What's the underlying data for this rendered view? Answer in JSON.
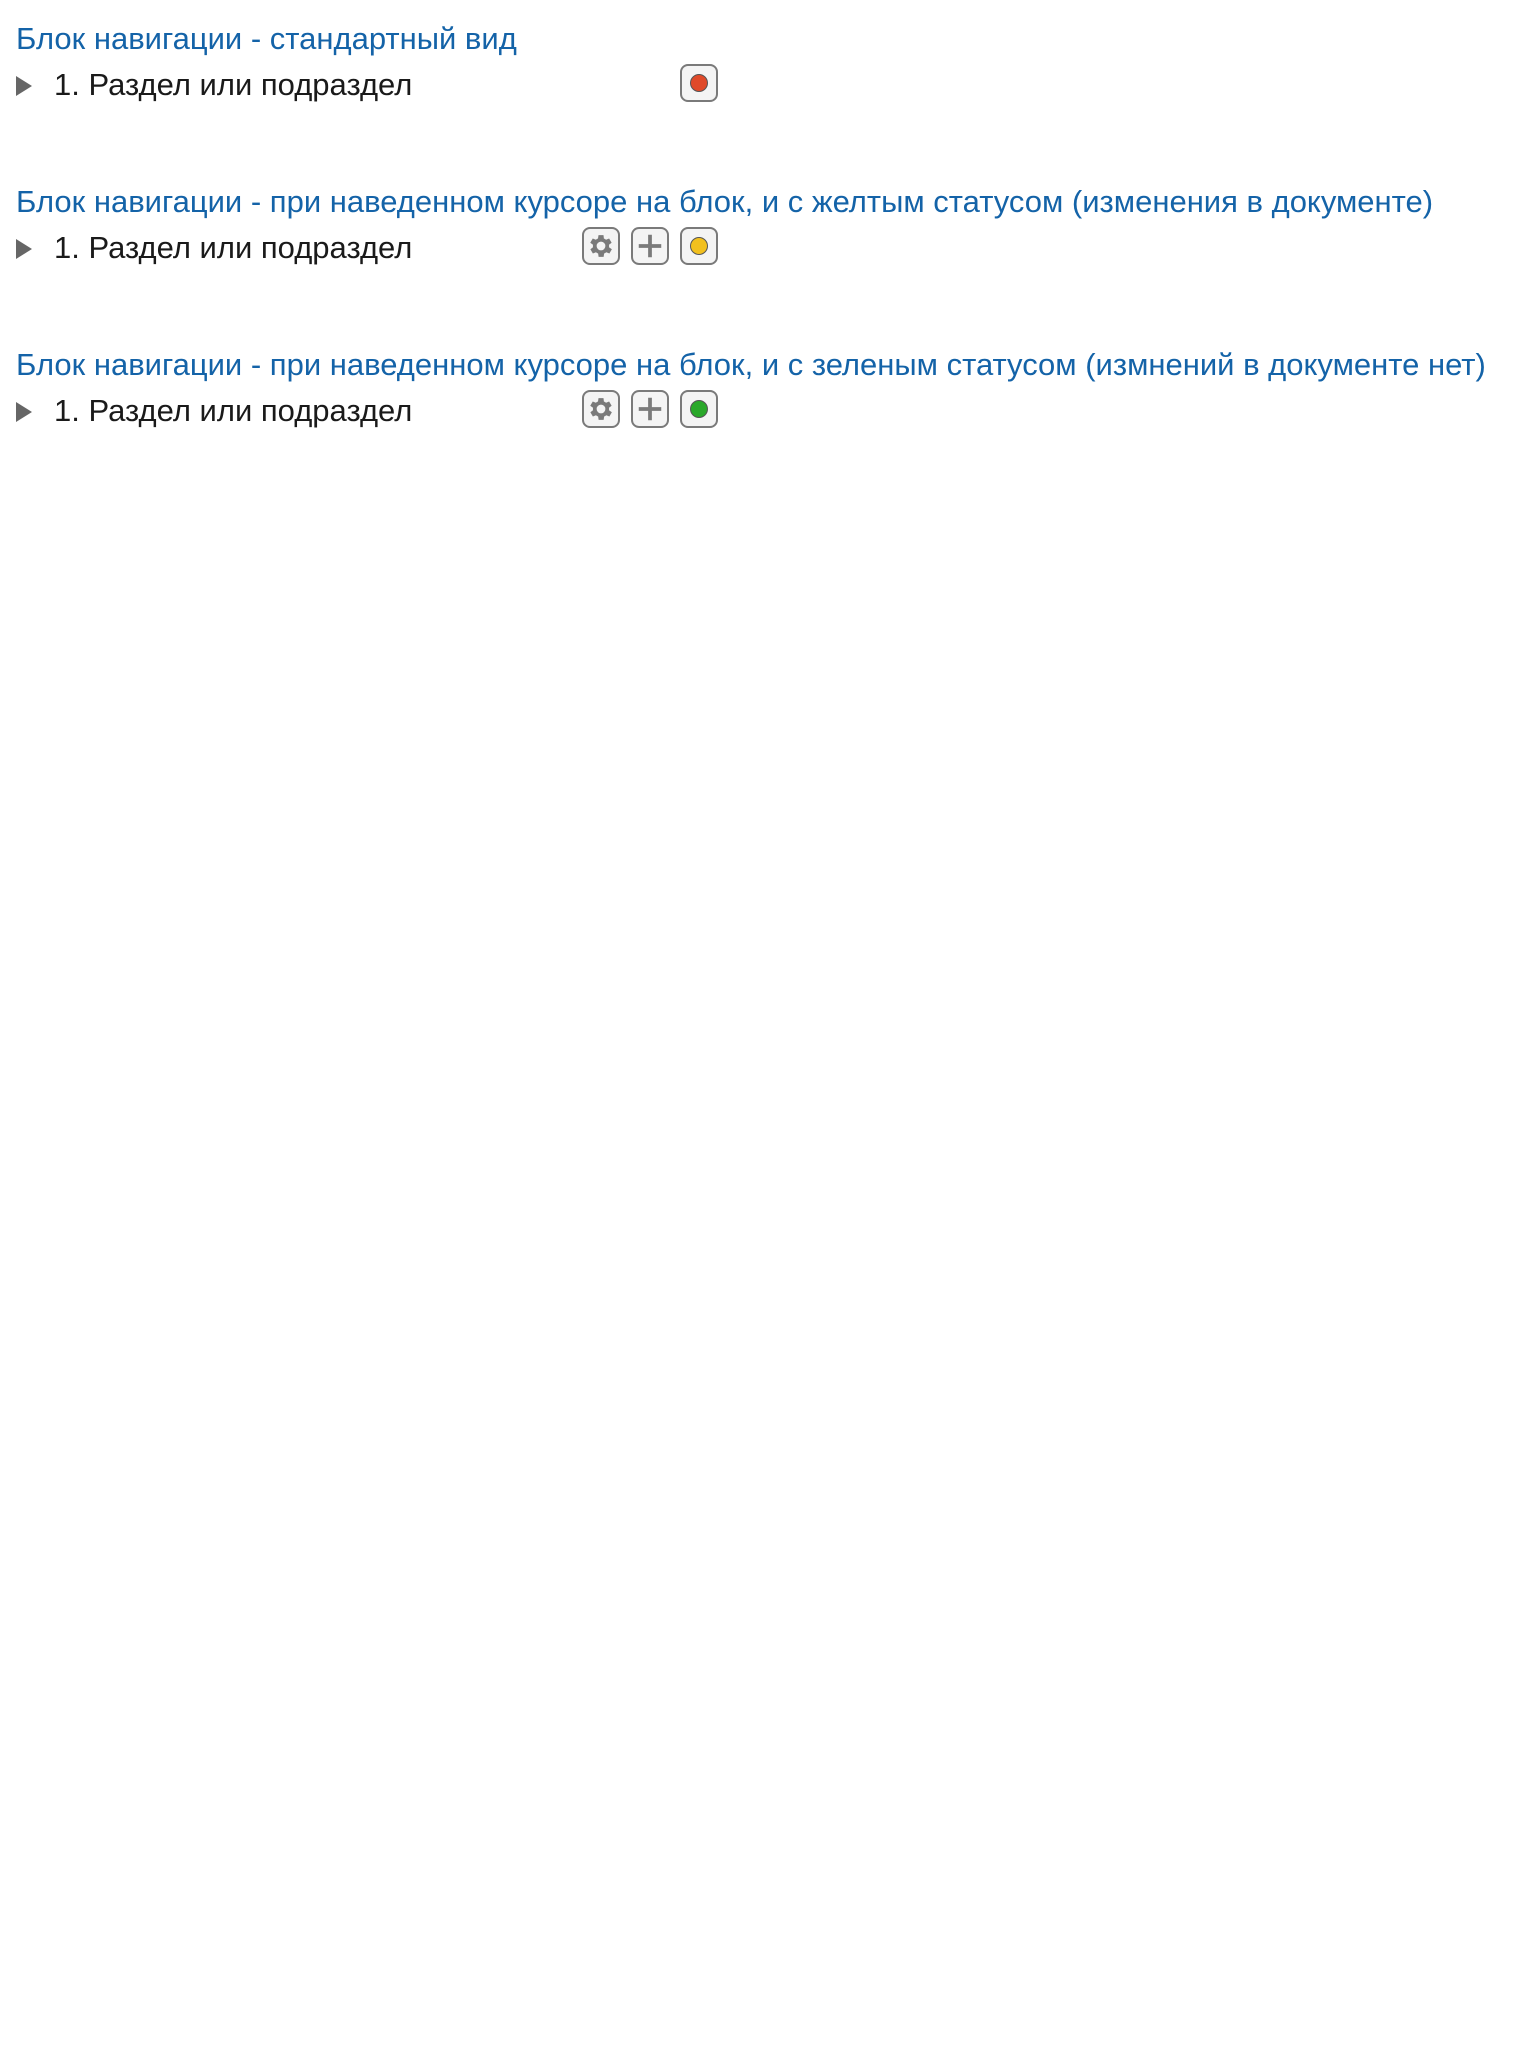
{
  "blocks": [
    {
      "title": "Блок навигации - стандартный вид",
      "item": {
        "label": "1. Раздел или подраздел",
        "show_actions": false,
        "status": {
          "state": "red",
          "color": "#e04a2a"
        }
      }
    },
    {
      "title": "Блок навигации - при наведенном курсоре на блок, и с желтым статусом (изменения в документе)",
      "item": {
        "label": "1. Раздел или подраздел",
        "show_actions": true,
        "status": {
          "state": "yellow",
          "color": "#f2c01e"
        }
      }
    },
    {
      "title": "Блок навигации - при наведенном курсоре на блок, и с зеленым статусом (измнений в документе нет)",
      "item": {
        "label": "1. Раздел или подраздел",
        "show_actions": true,
        "status": {
          "state": "green",
          "color": "#2aa82a"
        }
      }
    }
  ],
  "icons": {
    "expand": "triangle-right-icon",
    "settings": "gear-icon",
    "add": "plus-icon",
    "status": "status-dot-icon"
  },
  "colors": {
    "title": "#1463a8",
    "text": "#1a1a1a",
    "icon": "#7a7a7a"
  }
}
